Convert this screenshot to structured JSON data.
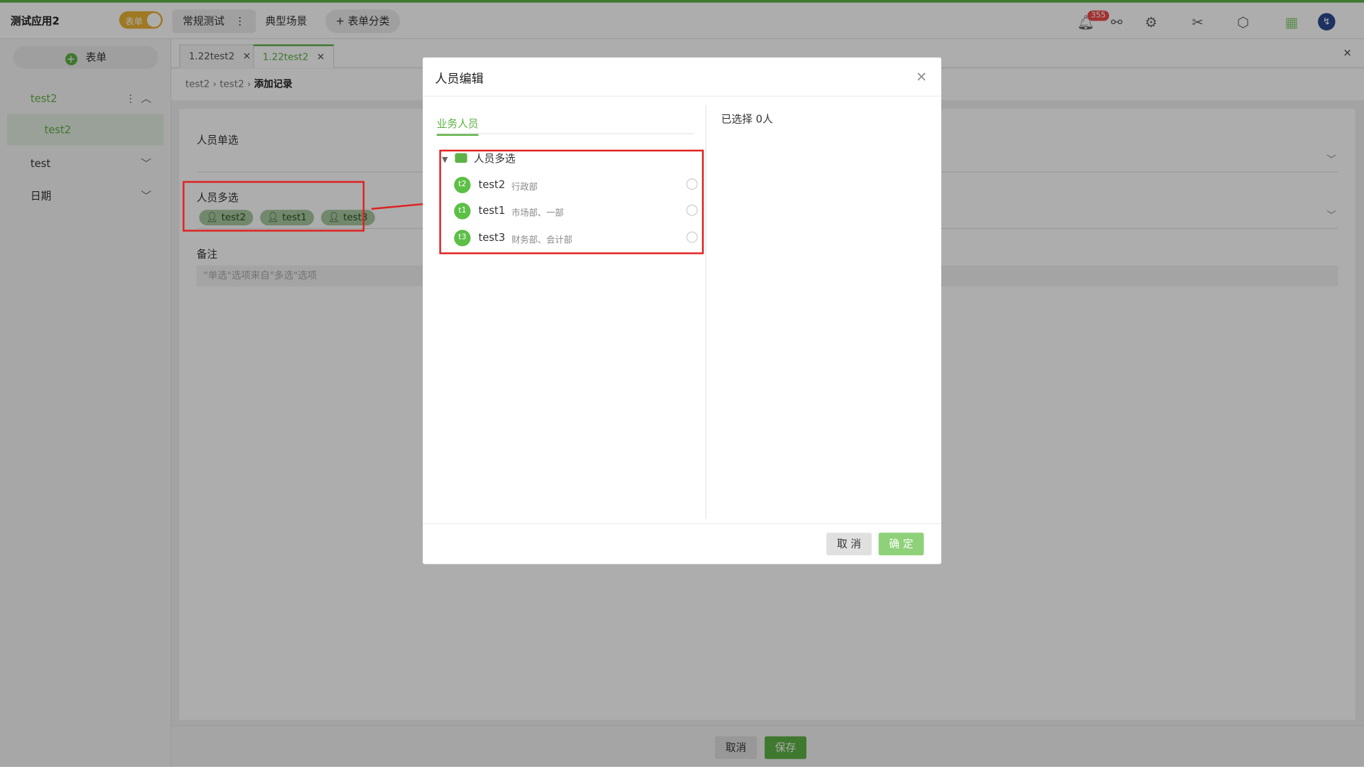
{
  "topbar": {
    "app_title": "测试应用2",
    "toggle_label": "表单",
    "tabs": [
      "常规测试",
      "典型场景"
    ],
    "tab_more": "⋮",
    "add_category": "表单分类",
    "notification_count": "355"
  },
  "sidebar": {
    "add_label": "表单",
    "items": [
      {
        "label": "test2"
      },
      {
        "label": "test2"
      },
      {
        "label": "test"
      },
      {
        "label": "日期"
      }
    ]
  },
  "form_tabs": [
    "1.22test2",
    "1.22test2"
  ],
  "breadcrumb": [
    "test2",
    "test2",
    "添加记录"
  ],
  "form": {
    "single_label": "人员单选",
    "multi_label": "人员多选",
    "chips": [
      "test2",
      "test1",
      "test3"
    ],
    "remark_label": "备注",
    "remark_placeholder": "\"单选\"选项来自\"多选\"选项"
  },
  "bottom": {
    "cancel": "取消",
    "save": "保存"
  },
  "modal": {
    "title": "人员编辑",
    "tab": "业务人员",
    "root_node": "人员多选",
    "people": [
      {
        "avatar": "t2",
        "name": "test2",
        "dept": "行政部"
      },
      {
        "avatar": "t1",
        "name": "test1",
        "dept": "市场部、一部"
      },
      {
        "avatar": "t3",
        "name": "test3",
        "dept": "财务部、会计部"
      }
    ],
    "selected_count": "已选择 0人",
    "cancel": "取 消",
    "confirm": "确 定"
  },
  "colors": {
    "accent": "#5db146",
    "highlight": "#e02020"
  }
}
